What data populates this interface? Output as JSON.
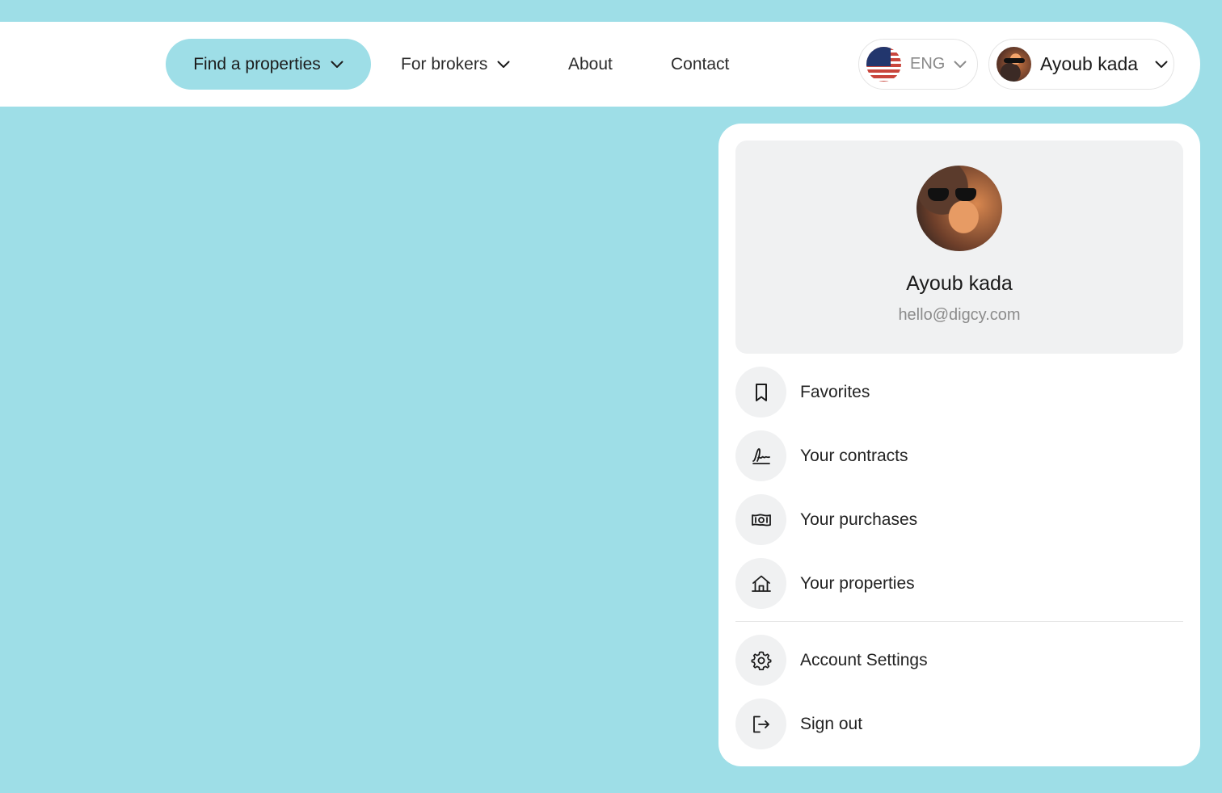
{
  "nav": {
    "find_label": "Find a properties",
    "brokers_label": "For brokers",
    "about_label": "About",
    "contact_label": "Contact"
  },
  "language": {
    "label": "ENG"
  },
  "user": {
    "name": "Ayoub kada",
    "email": "hello@digcy.com"
  },
  "menu": {
    "items": [
      {
        "label": "Favorites",
        "icon": "bookmark-icon"
      },
      {
        "label": "Your contracts",
        "icon": "signature-icon"
      },
      {
        "label": "Your purchases",
        "icon": "banknote-icon"
      },
      {
        "label": "Your properties",
        "icon": "home-icon"
      }
    ],
    "settings": {
      "label": "Account Settings",
      "icon": "gear-icon"
    },
    "signout": {
      "label": "Sign out",
      "icon": "sign-out-icon"
    }
  },
  "colors": {
    "accent": "#9edee7",
    "surface": "#ffffff",
    "muted": "#f0f1f2"
  }
}
